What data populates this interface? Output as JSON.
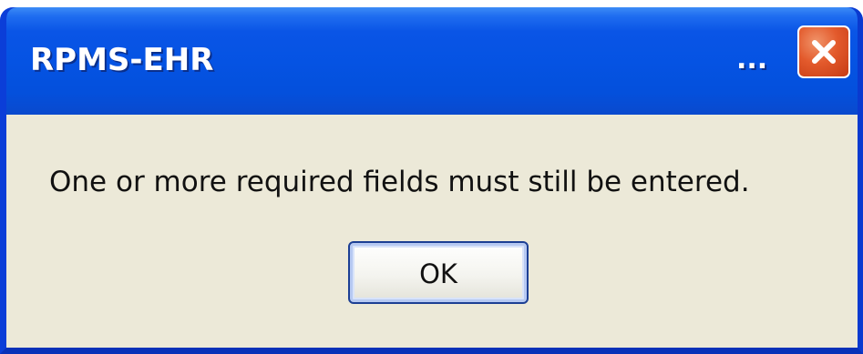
{
  "dialog": {
    "title": "RPMS-EHR",
    "title_overflow": "...",
    "message": "One or more required fields must still be entered.",
    "ok_label": "OK",
    "close_icon": "close-icon"
  },
  "colors": {
    "titlebar": "#0553e3",
    "frame": "#0b3ed8",
    "client_background": "#ece9d8",
    "close_button": "#e35a2c",
    "button_border": "#1c3f94"
  }
}
